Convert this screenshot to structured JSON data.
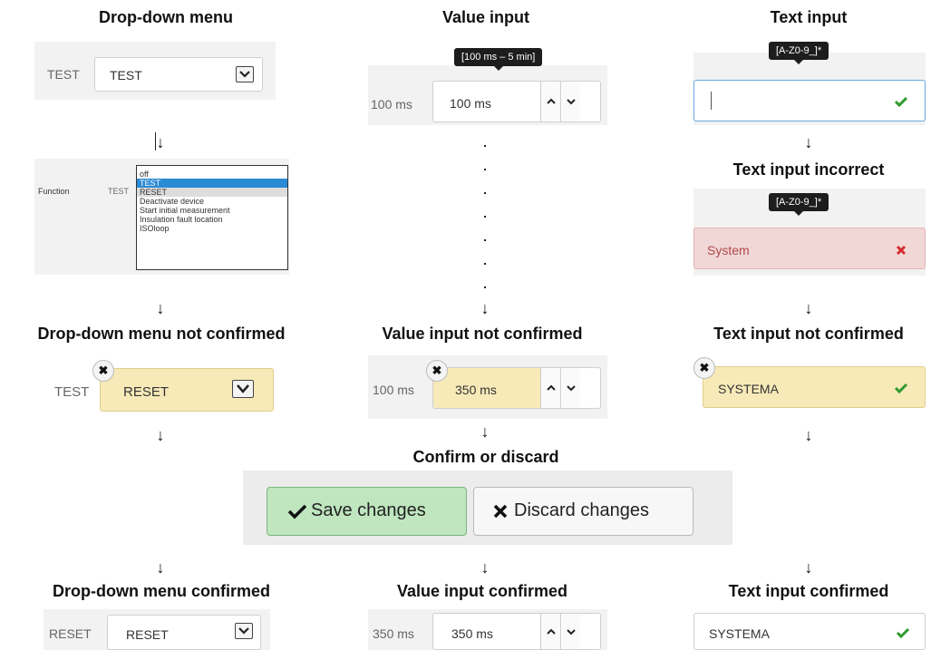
{
  "columns": {
    "dropdown": {
      "title": "Drop-down menu",
      "prefix": "TEST",
      "value": "TEST",
      "list_label": "Function",
      "list_prefix": "TEST",
      "options": [
        "off",
        "TEST",
        "RESET",
        "Deactivate device",
        "Start initial measurement",
        "Insulation fault location",
        "ISOloop"
      ],
      "not_confirmed_title": "Drop-down menu not confirmed",
      "not_confirmed_prefix": "TEST",
      "not_confirmed_value": "RESET",
      "confirmed_title": "Drop-down menu confirmed",
      "confirmed_prefix": "RESET",
      "confirmed_value": "RESET"
    },
    "value": {
      "title": "Value input",
      "tooltip": "[100 ms – 5 min]",
      "prefix": "100 ms",
      "value": "100 ms",
      "not_confirmed_title": "Value input not confirmed",
      "not_confirmed_prefix": "100 ms",
      "not_confirmed_value": "350 ms",
      "confirmed_title": "Value input confirmed",
      "confirmed_prefix": "350 ms",
      "confirmed_value": "350 ms"
    },
    "text": {
      "title": "Text input",
      "tooltip": "[A-Z0-9_]*",
      "incorrect_title": "Text input incorrect",
      "incorrect_tooltip": "[A-Z0-9_]*",
      "incorrect_value": "System",
      "not_confirmed_title": "Text input not confirmed",
      "not_confirmed_value": "SYSTEMA",
      "confirmed_title": "Text input confirmed",
      "confirmed_value": "SYSTEMA"
    }
  },
  "confirm": {
    "title": "Confirm or discard",
    "save_label": "Save changes",
    "discard_label": "Discard changes"
  },
  "arrow_glyph": "↓",
  "colors": {
    "unconfirmed_bg": "#f7eab8",
    "incorrect_bg": "#f2d7d7",
    "valid_check": "#2e9b2e",
    "invalid_cross": "#d42c2c",
    "focus_border": "#6aa7e0",
    "save_bg": "#bfe6bf",
    "discard_bg": "#f7f7f7",
    "list_selected": "#2a8ad3"
  },
  "icons": [
    "chevron-down-icon",
    "chevron-up-icon",
    "check-icon",
    "cross-icon",
    "close-icon"
  ]
}
